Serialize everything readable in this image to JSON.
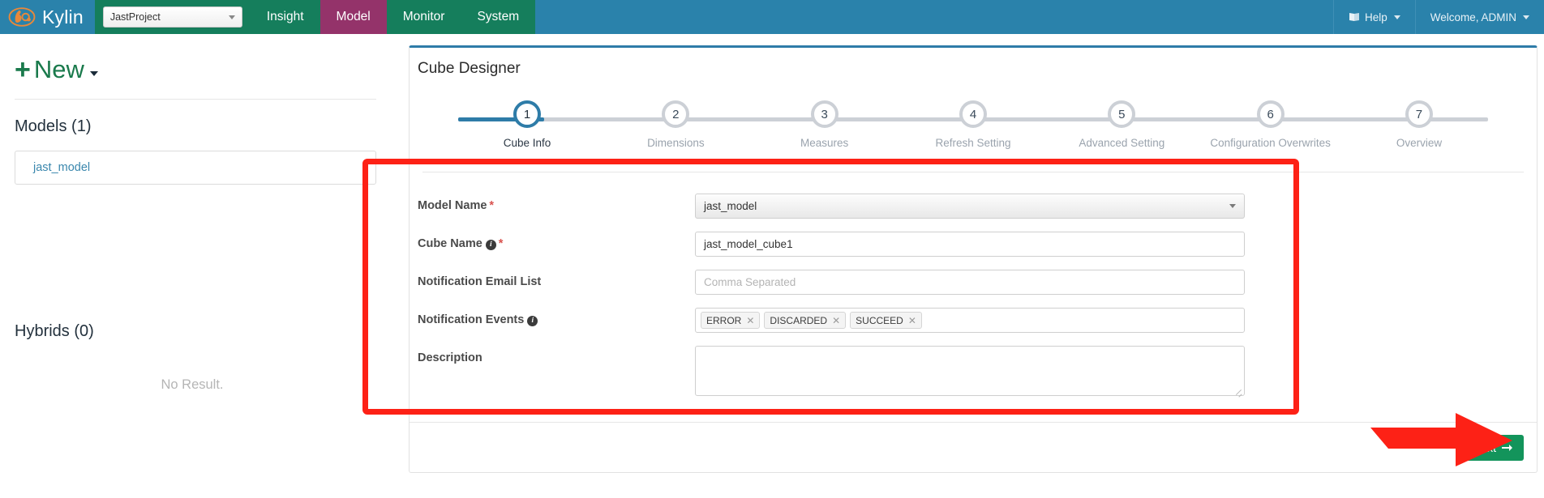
{
  "navbar": {
    "brand": "Kylin",
    "brand_logo_icon": "kylin-logo-icon",
    "project_selector": {
      "value": "JastProject",
      "caret_icon": "chevron-down-icon"
    },
    "links": [
      {
        "label": "Insight",
        "active": false
      },
      {
        "label": "Model",
        "active": true
      },
      {
        "label": "Monitor",
        "active": false
      },
      {
        "label": "System",
        "active": false
      }
    ],
    "help": {
      "label": "Help",
      "icon": "book-icon",
      "caret_icon": "chevron-down-icon"
    },
    "user": {
      "label": "Welcome, ADMIN",
      "caret_icon": "chevron-down-icon"
    },
    "colors": {
      "left_bg": "#157e5c",
      "right_bg": "#2a82ab",
      "active_bg": "#94336a"
    }
  },
  "sidebar": {
    "new_button": {
      "label": "New",
      "plus_icon": "plus-icon",
      "caret_icon": "caret-down-icon"
    },
    "models_heading": "Models (1)",
    "models": [
      {
        "name": "jast_model"
      }
    ],
    "hybrids_heading": "Hybrids (0)",
    "hybrids_empty": "No Result."
  },
  "main": {
    "panel_title": "Cube Designer",
    "wizard": {
      "current_step": 1,
      "steps": [
        {
          "num": "1",
          "label": "Cube Info"
        },
        {
          "num": "2",
          "label": "Dimensions"
        },
        {
          "num": "3",
          "label": "Measures"
        },
        {
          "num": "4",
          "label": "Refresh Setting"
        },
        {
          "num": "5",
          "label": "Advanced Setting"
        },
        {
          "num": "6",
          "label": "Configuration Overwrites"
        },
        {
          "num": "7",
          "label": "Overview"
        }
      ]
    },
    "form": {
      "model_name": {
        "label": "Model Name",
        "required_mark": "*",
        "value": "jast_model",
        "caret_icon": "chevron-down-icon"
      },
      "cube_name": {
        "label": "Cube Name",
        "info_icon": "info-icon",
        "required_mark": "*",
        "value": "jast_model_cube1"
      },
      "notification_email": {
        "label": "Notification Email List",
        "placeholder": "Comma Separated",
        "value": ""
      },
      "notification_events": {
        "label": "Notification Events",
        "info_icon": "info-icon",
        "tags": [
          {
            "label": "ERROR",
            "remove_icon": "close-icon"
          },
          {
            "label": "DISCARDED",
            "remove_icon": "close-icon"
          },
          {
            "label": "SUCCEED",
            "remove_icon": "close-icon"
          }
        ]
      },
      "description": {
        "label": "Description",
        "value": ""
      }
    },
    "footer": {
      "next_button": {
        "label": "Next",
        "arrow_icon": "arrow-right-icon"
      }
    }
  },
  "annotations": {
    "highlight_box_color": "#fd2116",
    "arrow_color": "#fd2116"
  }
}
